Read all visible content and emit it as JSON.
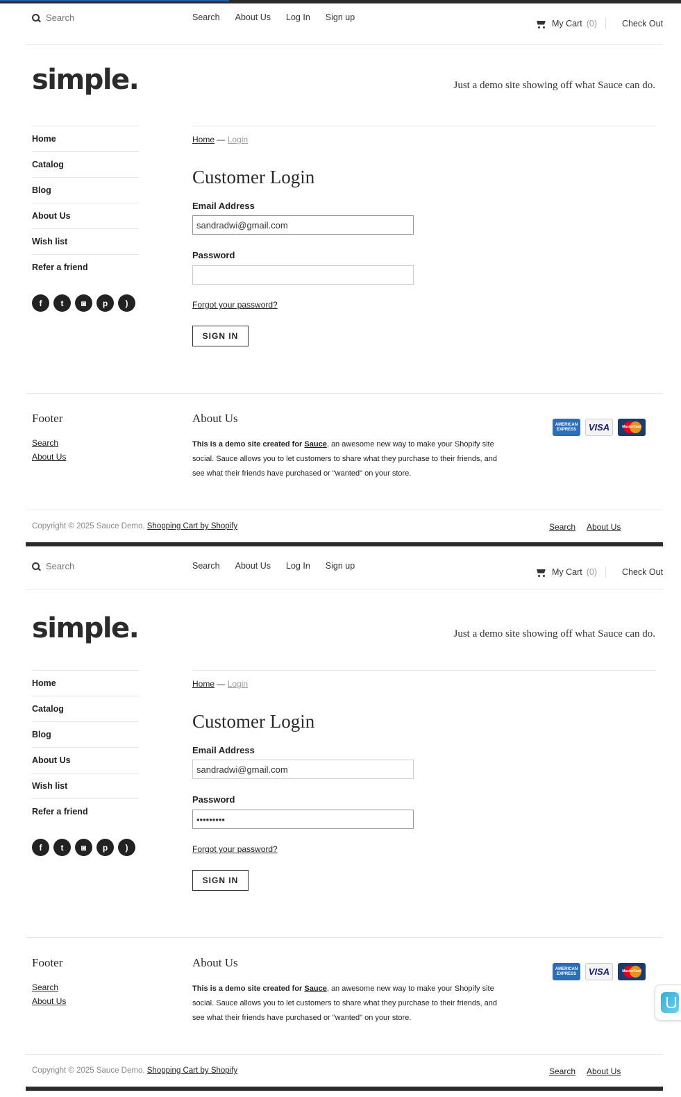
{
  "frames": [
    {
      "header": {
        "search_placeholder": "Search",
        "nav": [
          "Search",
          "About Us",
          "Log In",
          "Sign up"
        ],
        "cart_label": "My Cart",
        "cart_count": "(0)",
        "checkout": "Check Out"
      },
      "logo": "simple.",
      "tagline": "Just a demo site showing off what Sauce can do.",
      "sidebar": [
        "Home",
        "Catalog",
        "Blog",
        "About Us",
        "Wish list",
        "Refer a friend"
      ],
      "social_icons": [
        "facebook-icon",
        "twitter-icon",
        "instagram-icon",
        "pinterest-icon",
        "rss-icon"
      ],
      "breadcrumb": {
        "home": "Home",
        "sep": " — ",
        "current": "Login"
      },
      "title": "Customer Login",
      "email_label": "Email Address",
      "email_value": "sandradwi@gmail.com",
      "password_label": "Password",
      "password_value": "",
      "forgot": "Forgot your password?",
      "signin": "SIGN IN",
      "footer": {
        "col1_title": "Footer",
        "col1_links": [
          "Search",
          "About Us"
        ],
        "col2_title": "About Us",
        "about_bold": "This is a demo site created for",
        "about_sauce": "Sauce",
        "about_rest": ", an awesome new way to make your Shopify site social. Sauce allows you to let customers to share what they purchase to their friends, and see what their friends have purchased or \"wanted\" on your store.",
        "cards": [
          "AMERICAN EXPRESS",
          "VISA",
          "MasterCard"
        ],
        "copyright": "Copyright © 2025 Sauce Demo.",
        "shopify": "Shopify",
        "shopify_prefix": "Shopping Cart by ",
        "bottom_links": [
          "Search",
          "About Us"
        ]
      }
    },
    {
      "header": {
        "search_placeholder": "Search",
        "nav": [
          "Search",
          "About Us",
          "Log In",
          "Sign up"
        ],
        "cart_label": "My Cart",
        "cart_count": "(0)",
        "checkout": "Check Out"
      },
      "logo": "simple.",
      "tagline": "Just a demo site showing off what Sauce can do.",
      "sidebar": [
        "Home",
        "Catalog",
        "Blog",
        "About Us",
        "Wish list",
        "Refer a friend"
      ],
      "social_icons": [
        "facebook-icon",
        "twitter-icon",
        "instagram-icon",
        "pinterest-icon",
        "rss-icon"
      ],
      "breadcrumb": {
        "home": "Home",
        "sep": " — ",
        "current": "Login"
      },
      "title": "Customer Login",
      "email_label": "Email Address",
      "email_value": "sandradwi@gmail.com",
      "password_label": "Password",
      "password_value": "•••••••••",
      "forgot": "Forgot your password?",
      "signin": "SIGN IN",
      "footer": {
        "col1_title": "Footer",
        "col1_links": [
          "Search",
          "About Us"
        ],
        "col2_title": "About Us",
        "about_bold": "This is a demo site created for",
        "about_sauce": "Sauce",
        "about_rest": ", an awesome new way to make your Shopify site social. Sauce allows you to let customers to share what they purchase to their friends, and see what their friends have purchased or \"wanted\" on your store.",
        "cards": [
          "AMERICAN EXPRESS",
          "VISA",
          "MasterCard"
        ],
        "copyright": "Copyright © 2025 Sauce Demo.",
        "shopify": "Shopify",
        "shopify_prefix": "Shopping Cart by ",
        "bottom_links": [
          "Search",
          "About Us"
        ]
      }
    }
  ],
  "colors": {
    "text": "#222222",
    "muted": "#999999",
    "rule": "#e6e6e6",
    "bar": "#2b2b2b",
    "accent": "#1f5fa8"
  }
}
